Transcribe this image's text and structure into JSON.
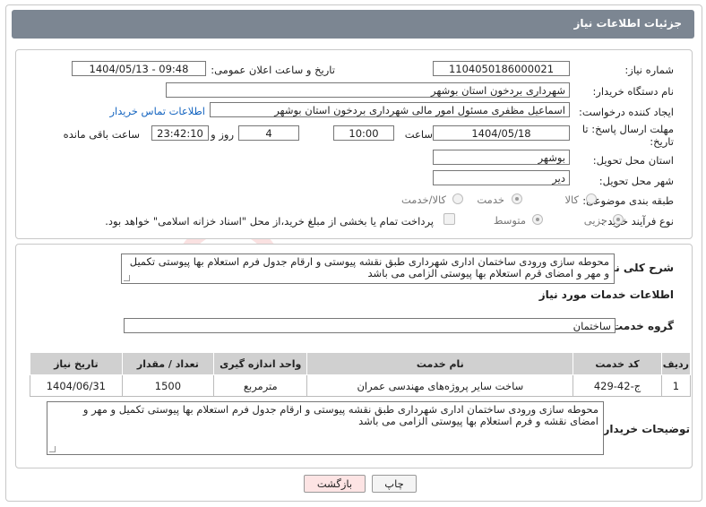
{
  "header": {
    "title": "جزئیات اطلاعات نیاز"
  },
  "fields": {
    "need_number_label": "شماره نیاز:",
    "need_number": "1104050186000021",
    "announce_label": "تاریخ و ساعت اعلان عمومی:",
    "announce_value": "1404/05/13 - 09:48",
    "buyer_org_label": "نام دستگاه خریدار:",
    "buyer_org": "شهرداری بردخون استان بوشهر",
    "creator_label": "ایجاد کننده درخواست:",
    "creator": "اسماعیل مظفری مسئول امور مالی شهرداری بردخون استان بوشهر",
    "contact_link": "اطلاعات تماس خریدار",
    "deadline_label": "مهلت ارسال پاسخ: تا تاریخ:",
    "deadline_date": "1404/05/18",
    "time_label": "ساعت",
    "deadline_time": "10:00",
    "days_value": "4",
    "days_label": "روز و",
    "remaining_time": "23:42:10",
    "remaining_label": "ساعت باقی مانده",
    "province_label": "استان محل تحویل:",
    "province": "بوشهر",
    "city_label": "شهر محل تحویل:",
    "city": "دیر",
    "category_label": "طبقه بندی موضوعی:",
    "category_options": [
      "کالا",
      "خدمت",
      "کالا/خدمت"
    ],
    "category_selected": "خدمت",
    "process_label": "نوع فرآیند خرید :",
    "process_options": [
      "جزیی",
      "متوسط"
    ],
    "process_selected": "جزیی",
    "payment_note": "پرداخت تمام یا بخشی از مبلغ خرید،از محل \"اسناد خزانه اسلامی\" خواهد بود."
  },
  "description": {
    "label": "شرح کلی نیاز:",
    "text": "محوطه سازی ورودی ساختمان اداری شهرداری طبق نقشه پیوستی و ارقام جدول فرم استعلام بها پیوستی تکمیل و مهر و امضای قرم استعلام بها پیوستی الزامی می باشد"
  },
  "services": {
    "section_title": "اطلاعات خدمات مورد نیاز",
    "group_label": "گروه خدمت:",
    "group_value": "ساختمان",
    "columns": [
      "ردیف",
      "کد خدمت",
      "نام خدمت",
      "واحد اندازه گیری",
      "تعداد / مقدار",
      "تاریخ نیاز"
    ],
    "rows": [
      [
        "1",
        "ج-42-429",
        "ساخت سایر پروژه‌های مهندسی عمران",
        "مترمربع",
        "1500",
        "1404/06/31"
      ]
    ]
  },
  "buyer_notes": {
    "label": "توضیحات خریدار:",
    "text": "محوطه سازی ورودی ساختمان اداری شهرداری طبق نقشه پیوستی و ارقام جدول فرم استعلام بها پیوستی تکمیل و مهر و امضای نقشه و فرم استعلام بها پیوستی الزامی می باشد"
  },
  "buttons": {
    "print": "چاپ",
    "back": "بازگشت"
  },
  "colors": {
    "header_bg": "#7c8692",
    "table_header_bg": "#d0d0d0",
    "link": "#1565c0",
    "back_btn_bg": "#fde4e4"
  }
}
